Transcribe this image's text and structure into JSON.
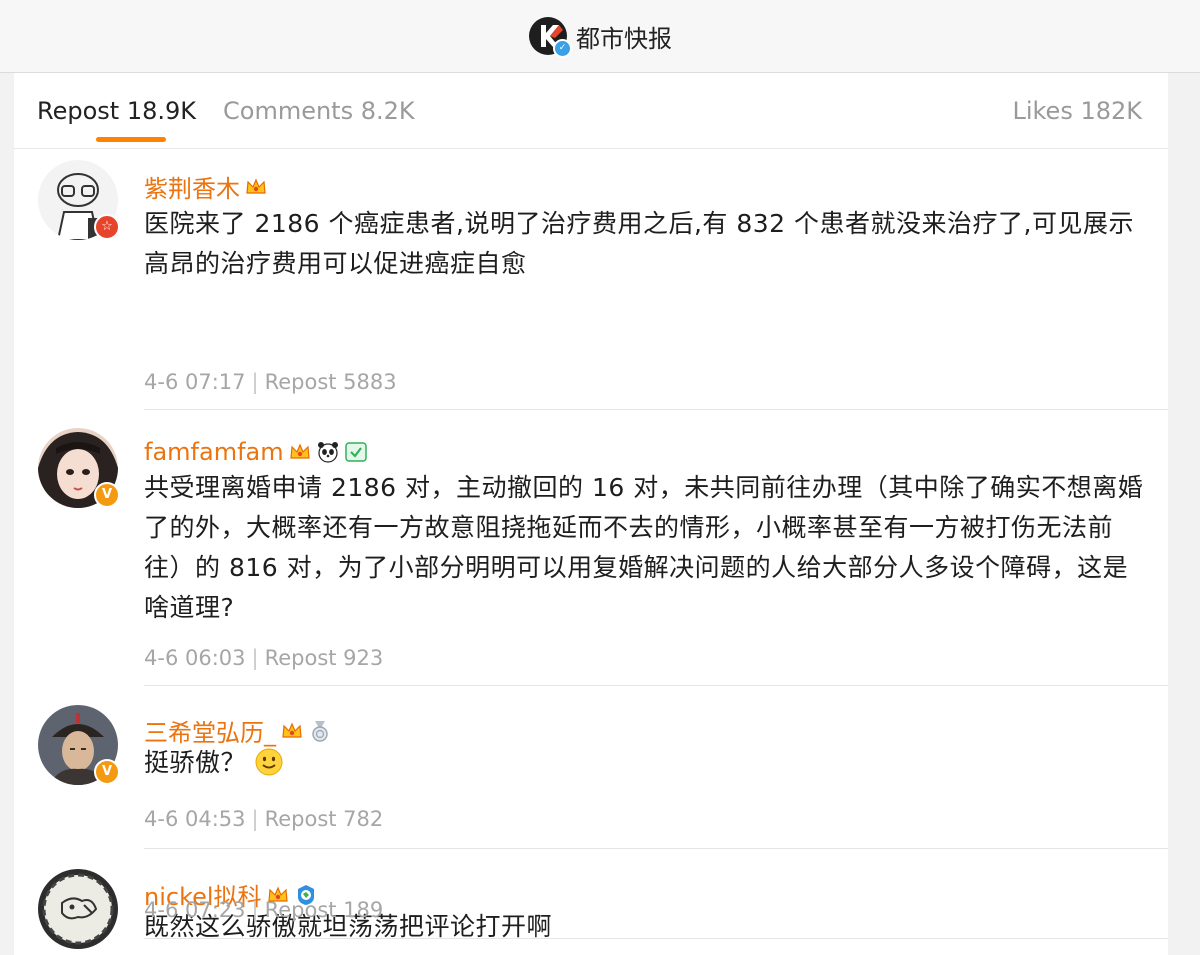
{
  "header": {
    "account_name": "都市快报",
    "logo_icon": "brand-k-logo",
    "verified_icon": "blue-verified-badge"
  },
  "tabs": {
    "repost": "Repost 18.9K",
    "comments": "Comments 8.2K",
    "likes": "Likes 182K",
    "active": "repost",
    "accent_color": "#ff8200"
  },
  "reposts": [
    {
      "username": "紫荆香木",
      "badges": [
        "crown-icon"
      ],
      "avatar_badge": "red-star-badge",
      "avatar_badge_text": "☆",
      "text": "医院来了 2186 个癌症患者,说明了治疗费用之后,有 832 个患者就没来治疗了,可见展示高昂的治疗费用可以促进癌症自愈",
      "date": "4-6 07:17",
      "repost_label": "Repost 5883"
    },
    {
      "username": "famfamfam",
      "badges": [
        "crown-icon",
        "panda-icon",
        "green-check-icon"
      ],
      "avatar_badge": "orange-v-badge",
      "avatar_badge_text": "V",
      "text": "共受理离婚申请 2186 对，主动撤回的 16 对，未共同前往办理（其中除了确实不想离婚了的外，大概率还有一方故意阻挠拖延而不去的情形，小概率甚至有一方被打伤无法前往）的 816 对，为了小部分明明可以用复婚解决问题的人给大部分人多设个障碍，这是啥道理?",
      "date": "4-6 06:03",
      "repost_label": "Repost 923"
    },
    {
      "username": "三希堂弘历_",
      "badges": [
        "crown-icon",
        "medal-icon"
      ],
      "avatar_badge": "orange-v-badge",
      "avatar_badge_text": "V",
      "text": "挺骄傲？",
      "emoji": "smile-emoji",
      "date": "4-6 04:53",
      "repost_label": "Repost 782"
    },
    {
      "username": "nickel拟科",
      "badges": [
        "crown-icon",
        "globe-icon"
      ],
      "avatar_badge": "",
      "avatar_badge_text": "",
      "text": "既然这么骄傲就坦荡荡把评论打开啊",
      "date": "4-6 07:23",
      "repost_label": "Repost 189"
    }
  ],
  "colors": {
    "username": "#eb7410",
    "meta": "#a6a6a6",
    "background": "#f2f2f2"
  }
}
